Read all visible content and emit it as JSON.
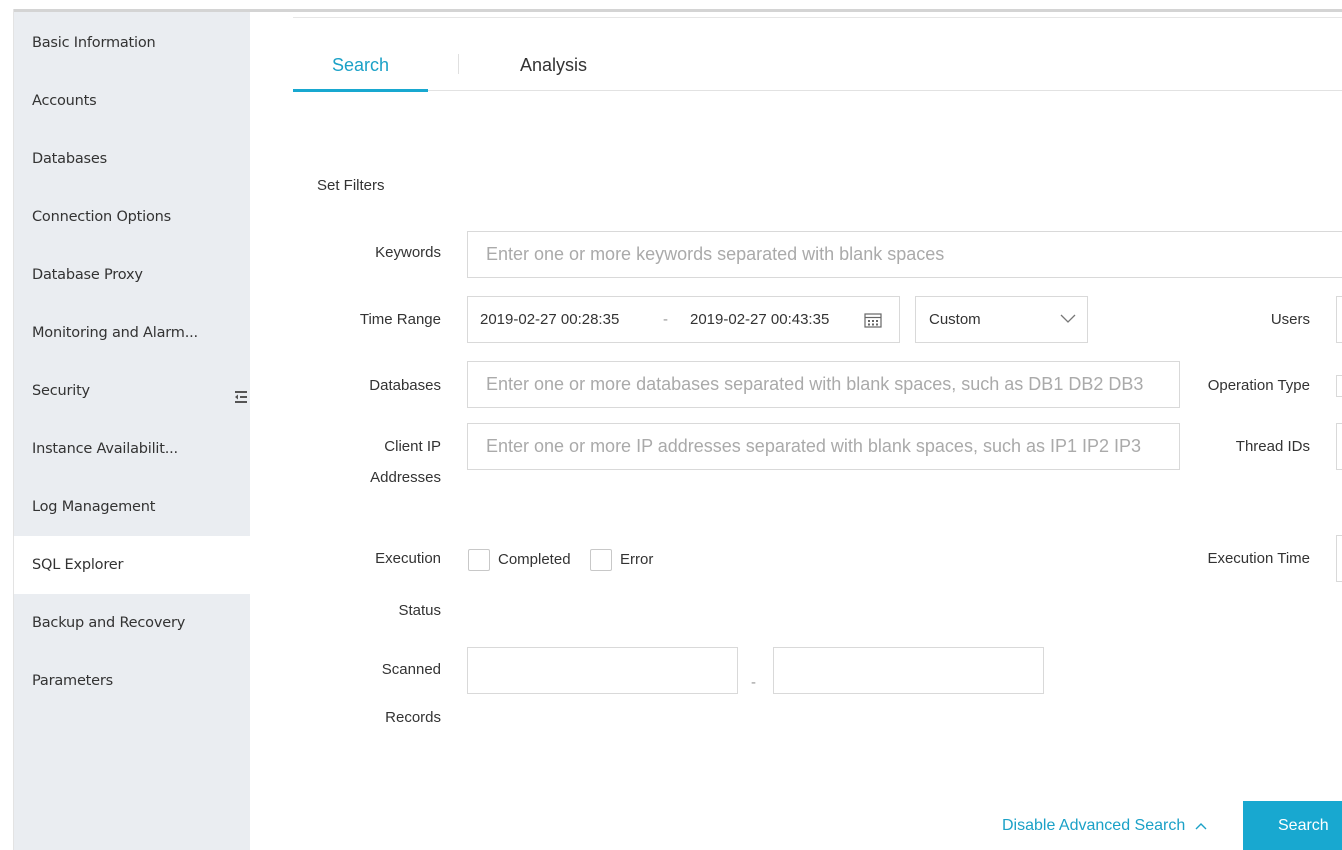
{
  "sidebar": {
    "items": [
      {
        "label": "Basic Information"
      },
      {
        "label": "Accounts"
      },
      {
        "label": "Databases"
      },
      {
        "label": "Connection Options"
      },
      {
        "label": "Database Proxy"
      },
      {
        "label": "Monitoring and Alarm..."
      },
      {
        "label": "Security"
      },
      {
        "label": "Instance Availabilit..."
      },
      {
        "label": "Log Management"
      },
      {
        "label": "SQL Explorer"
      },
      {
        "label": "Backup and Recovery"
      },
      {
        "label": "Parameters"
      }
    ],
    "active": "SQL Explorer",
    "collapse_icon": "collapse-menu-icon"
  },
  "tabs": [
    {
      "label": "Search",
      "active": true
    },
    {
      "label": "Analysis",
      "active": false
    }
  ],
  "filters": {
    "title": "Set Filters",
    "keywords": {
      "label": "Keywords",
      "placeholder": "Enter one or more keywords separated with blank spaces"
    },
    "time_range": {
      "label": "Time Range",
      "start": "2019-02-27 00:28:35",
      "separator": "-",
      "end": "2019-02-27 00:43:35",
      "calendar_icon": "calendar-icon",
      "preset": "Custom"
    },
    "users": {
      "label": "Users"
    },
    "databases": {
      "label": "Databases",
      "placeholder": "Enter one or more databases separated with blank spaces, such as DB1 DB2 DB3"
    },
    "operation_type": {
      "label": "Operation Type"
    },
    "client_ip": {
      "label_line1": "Client IP",
      "label_line2": "Addresses",
      "placeholder": "Enter one or more IP addresses separated with blank spaces, such as IP1 IP2 IP3"
    },
    "thread_ids": {
      "label": "Thread IDs"
    },
    "execution_status": {
      "label_line1": "Execution",
      "label_line2": "Status",
      "options": [
        {
          "label": "Completed",
          "checked": false
        },
        {
          "label": "Error",
          "checked": false
        }
      ]
    },
    "execution_time": {
      "label": "Execution Time"
    },
    "scanned_records": {
      "label_line1": "Scanned",
      "label_line2": "Records",
      "min": "",
      "separator": "-",
      "max": ""
    }
  },
  "actions": {
    "advanced_toggle": "Disable Advanced Search",
    "search_button": "Search"
  },
  "colors": {
    "accent": "#18a8d0",
    "sidebar_bg": "#eaedf1"
  }
}
